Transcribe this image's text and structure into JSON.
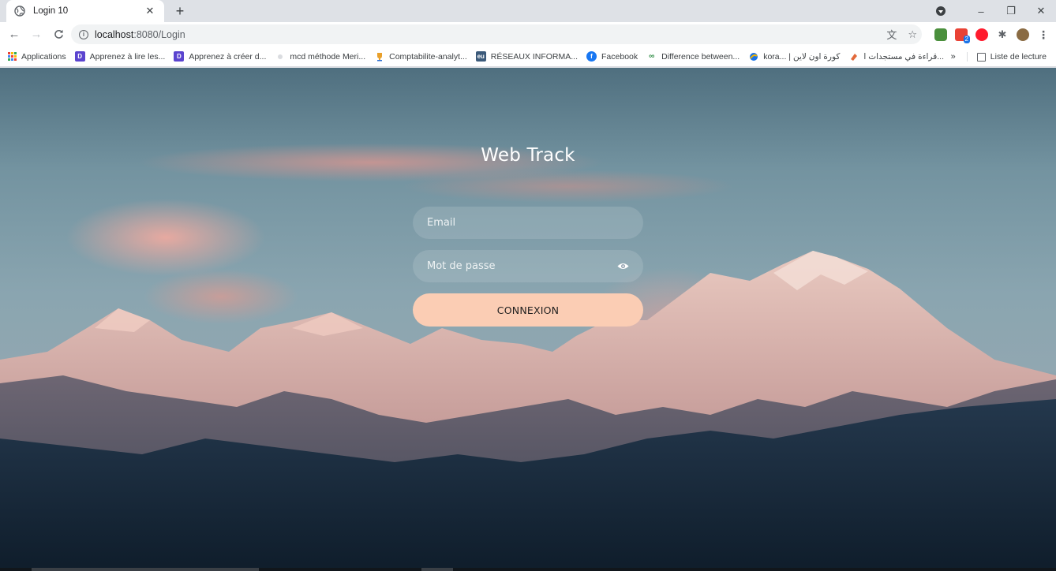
{
  "browser": {
    "tab_title": "Login 10",
    "tab_close": "✕",
    "new_tab": "+",
    "window_buttons": {
      "minimize": "–",
      "restore": "❐",
      "close": "✕"
    },
    "nav": {
      "back": "←",
      "forward": "→",
      "reload": "C"
    },
    "url_host": "localhost",
    "url_path": ":8080/Login",
    "omnibox_icons": [
      "translate-icon",
      "star-icon"
    ],
    "omnibox_glyphs": {
      "translate": "⽂",
      "star": "☆"
    },
    "extensions_glyph": "✱",
    "menu_glyph": "⋮"
  },
  "bookmarks": {
    "items": [
      {
        "label": "Applications",
        "icon": "apps-grid-icon",
        "color": ""
      },
      {
        "label": "Apprenez à lire les...",
        "icon": "d-logo-icon",
        "color": "#5b44cf"
      },
      {
        "label": "Apprenez à créer d...",
        "icon": "d-logo-icon",
        "color": "#5b44cf"
      },
      {
        "label": "mcd méthode Meri...",
        "icon": "dot-icon",
        "color": "#dadce0"
      },
      {
        "label": "Comptabilite-analyt...",
        "icon": "trophy-icon",
        "color": "#e9a02b"
      },
      {
        "label": "RÉSEAUX INFORMA...",
        "icon": "eu-logo-icon",
        "color": "#3c5a7a"
      },
      {
        "label": "Facebook",
        "icon": "facebook-icon",
        "color": "#1877f2"
      },
      {
        "label": "Difference between...",
        "icon": "geeks-icon",
        "color": "#2f8d46"
      },
      {
        "label": "kora... | كورة اون لاين",
        "icon": "kora-icon",
        "color": "#1a73e8"
      },
      {
        "label": "قراءة في مستجدات ا...",
        "icon": "book-icon",
        "color": "#e2693a"
      }
    ],
    "more": "»",
    "reading_list": "Liste de lecture"
  },
  "page": {
    "title": "Web Track",
    "email_placeholder": "Email",
    "password_placeholder": "Mot de passe",
    "submit_label": "CONNEXION",
    "button_color": "#fbcdb4"
  }
}
